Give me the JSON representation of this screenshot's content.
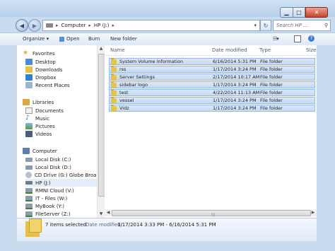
{
  "window": {
    "caption": {
      "minimize": "▁",
      "maximize": "□",
      "close": "✕"
    }
  },
  "address": {
    "segments": [
      "Computer",
      "HP (J:)"
    ],
    "separator": "▸",
    "search_placeholder": "Search HP ..."
  },
  "toolbar": {
    "organize": "Organize ▾",
    "open": "Open",
    "burn": "Burn",
    "new_folder": "New folder"
  },
  "nav": {
    "favorites_header": "Favorites",
    "favorites": [
      "Desktop",
      "Downloads",
      "Dropbox",
      "Recent Places"
    ],
    "libraries_header": "Libraries",
    "libraries": [
      "Documents",
      "Music",
      "Pictures",
      "Videos"
    ],
    "computer_header": "Computer",
    "drives": [
      "Local Disk (C:)",
      "Local Disk (D:)",
      "CD Drive (G:) Globe Broadban",
      "HP (J:)",
      "RMNI Cloud (V:)",
      "IT - Files (W:)",
      "MyBook (Y:)",
      "FileServer (Z:)"
    ]
  },
  "columns": {
    "name": "Name",
    "date": "Date modified",
    "type": "Type",
    "size": "Size"
  },
  "files": [
    {
      "name": "System Volume Information",
      "date": "6/16/2014 5:31 PM",
      "type": "File folder"
    },
    {
      "name": "rss",
      "date": "1/17/2014 3:24 PM",
      "type": "File folder"
    },
    {
      "name": "Server Settings",
      "date": "2/17/2014 10:17 AM",
      "type": "File folder"
    },
    {
      "name": "sidebar logo",
      "date": "1/17/2014 3:24 PM",
      "type": "File folder"
    },
    {
      "name": "test",
      "date": "4/22/2014 11:13 AM",
      "type": "File folder"
    },
    {
      "name": "vessel",
      "date": "1/17/2014 3:24 PM",
      "type": "File folder"
    },
    {
      "name": "Vidz",
      "date": "1/17/2014 3:24 PM",
      "type": "File folder"
    }
  ],
  "details": {
    "selection": "7 items selected",
    "date_label": "Date modified:",
    "date_value": "1/17/2014 3:33 PM - 6/16/2014 5:31 PM"
  },
  "colors": {
    "accent": "#c9dcef",
    "selection": "#cde0f7",
    "folder": "#e7c34a"
  }
}
